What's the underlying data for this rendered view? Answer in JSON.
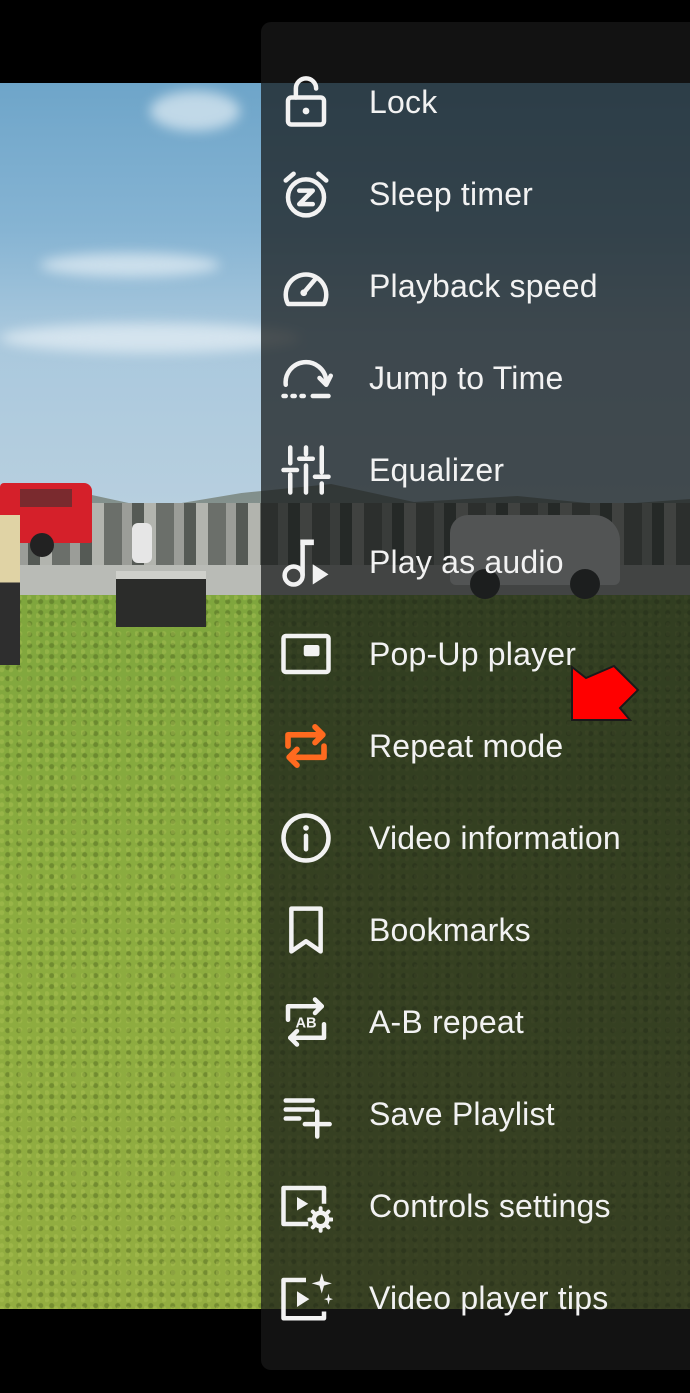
{
  "screen": {
    "type": "video player overflow menu"
  },
  "menu": {
    "items": [
      {
        "id": "lock",
        "label": "Lock",
        "icon": "lock-open-icon"
      },
      {
        "id": "sleep-timer",
        "label": "Sleep timer",
        "icon": "alarm-snooze-icon"
      },
      {
        "id": "playback-speed",
        "label": "Playback speed",
        "icon": "speedometer-icon"
      },
      {
        "id": "jump-to-time",
        "label": "Jump to Time",
        "icon": "jump-arc-icon"
      },
      {
        "id": "equalizer",
        "label": "Equalizer",
        "icon": "equalizer-sliders-icon"
      },
      {
        "id": "play-as-audio",
        "label": "Play as audio",
        "icon": "music-note-play-icon"
      },
      {
        "id": "pop-up-player",
        "label": "Pop-Up player",
        "icon": "picture-in-picture-icon"
      },
      {
        "id": "repeat-mode",
        "label": "Repeat mode",
        "icon": "repeat-icon",
        "active": true
      },
      {
        "id": "video-information",
        "label": "Video information",
        "icon": "info-circle-icon"
      },
      {
        "id": "bookmarks",
        "label": "Bookmarks",
        "icon": "bookmark-icon"
      },
      {
        "id": "ab-repeat",
        "label": "A-B repeat",
        "icon": "ab-repeat-icon",
        "icon_text": "AB"
      },
      {
        "id": "save-playlist",
        "label": "Save Playlist",
        "icon": "playlist-add-icon"
      },
      {
        "id": "controls-settings",
        "label": "Controls settings",
        "icon": "video-settings-icon"
      },
      {
        "id": "video-player-tips",
        "label": "Video player tips",
        "icon": "video-sparkle-icon"
      }
    ]
  },
  "colors": {
    "icon_default": "#f2f2f2",
    "icon_active": "#ff6a1f",
    "annotation_arrow": "#ff0000",
    "panel_bar": "#121212"
  },
  "annotation": {
    "type": "arrow",
    "points_to": "repeat-mode"
  }
}
